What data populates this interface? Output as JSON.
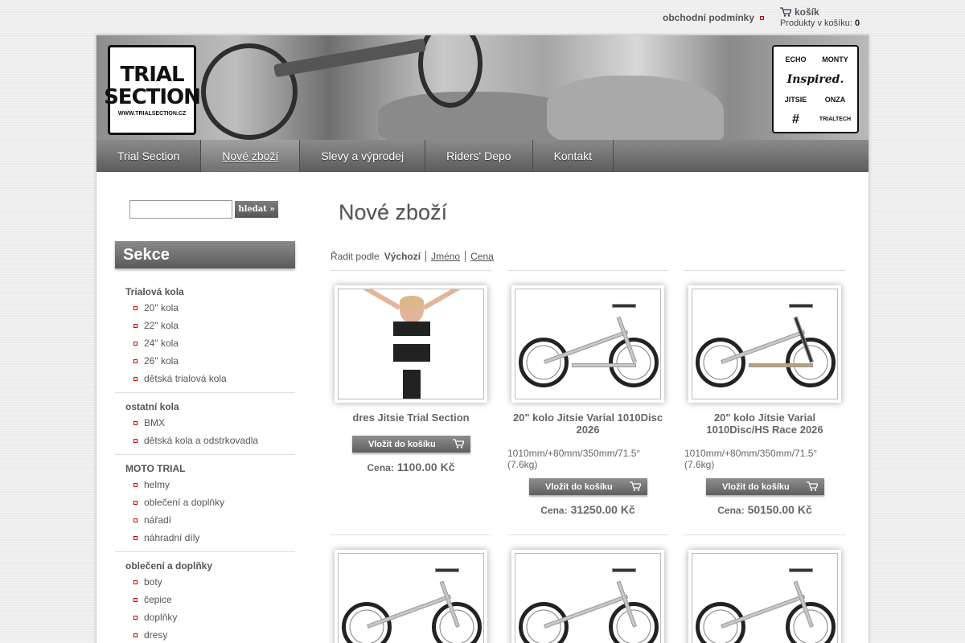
{
  "topbar": {
    "terms_label": "obchodní podmínky",
    "cart_label": "košík",
    "cart_count_label": "Produkty v košíku:",
    "cart_count": "0"
  },
  "header": {
    "logo_lines": [
      "TRIAL",
      "SECTION"
    ],
    "logo_url": "WWW.TRIALSECTION.CZ",
    "sponsors": [
      "ECHO",
      "MONTY",
      "Inspired.",
      "JITSIE",
      "ONZA",
      "#",
      "TRIALTECH"
    ]
  },
  "nav": [
    {
      "label": "Trial Section"
    },
    {
      "label": "Nové zboží"
    },
    {
      "label": "Slevy a výprodej"
    },
    {
      "label": "Riders' Depo"
    },
    {
      "label": "Kontakt"
    }
  ],
  "search": {
    "button_label": "hledat »",
    "placeholder": ""
  },
  "sidebar": {
    "title": "Sekce",
    "categories": [
      {
        "title": "Trialová kola",
        "items": [
          "20\" kola",
          "22\" kola",
          "24\" kola",
          "26\" kola",
          "dětská trialová kola"
        ]
      },
      {
        "title": "ostatní kola",
        "items": [
          "BMX",
          "dětská kola a odstrkovadla"
        ]
      },
      {
        "title": "MOTO TRIAL",
        "items": [
          "helmy",
          "oblečení a doplňky",
          "nářadí",
          "náhradní díly"
        ]
      },
      {
        "title": "oblečení a doplňky",
        "items": [
          "boty",
          "čepice",
          "doplňky",
          "dresy"
        ]
      }
    ]
  },
  "main": {
    "heading": "Nové zboží",
    "sort_label": "Řadit podle",
    "sort_current": "Výchozí",
    "sort_options": [
      "Jméno",
      "Cena"
    ],
    "buy_label": "Vložit do košíku",
    "price_label": "Cena:",
    "products": [
      {
        "name": "dres Jitsie Trial Section",
        "desc": "",
        "price": "1100.00 Kč"
      },
      {
        "name": "20\" kolo Jitsie Varial 1010Disc 2026",
        "desc": "1010mm/+80mm/350mm/71.5° (7.6kg)",
        "price": "31250.00 Kč"
      },
      {
        "name": "20\" kolo Jitsie Varial 1010Disc/HS Race 2026",
        "desc": "1010mm/+80mm/350mm/71.5° (7.6kg)",
        "price": "50150.00 Kč"
      }
    ]
  }
}
